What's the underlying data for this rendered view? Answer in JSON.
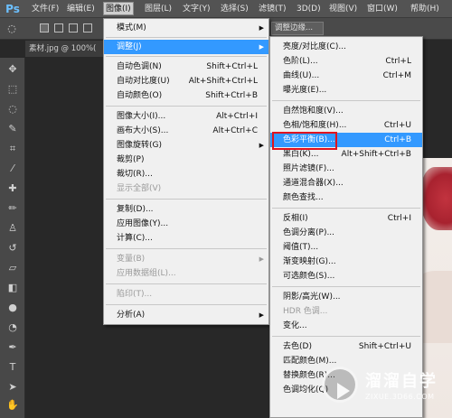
{
  "app": {
    "logo": "Ps"
  },
  "menubar": [
    "文件(F)",
    "编辑(E)",
    "图像(I)",
    "图层(L)",
    "文字(Y)",
    "选择(S)",
    "滤镜(T)",
    "3D(D)",
    "视图(V)",
    "窗口(W)",
    "帮助(H)"
  ],
  "options_bar": {
    "button_label": "调整边缘..."
  },
  "document_tab": {
    "title": "素材.jpg @ 100%("
  },
  "image_menu": {
    "items": [
      {
        "label": "模式(M)",
        "shortcut": "",
        "submenu": true,
        "disabled": false
      },
      {
        "label": "调整(J)",
        "shortcut": "",
        "submenu": true,
        "disabled": false,
        "highlighted": true
      },
      {
        "label": "自动色调(N)",
        "shortcut": "Shift+Ctrl+L",
        "disabled": false
      },
      {
        "label": "自动对比度(U)",
        "shortcut": "Alt+Shift+Ctrl+L",
        "disabled": false
      },
      {
        "label": "自动颜色(O)",
        "shortcut": "Shift+Ctrl+B",
        "disabled": false
      },
      {
        "label": "图像大小(I)...",
        "shortcut": "Alt+Ctrl+I",
        "disabled": false
      },
      {
        "label": "画布大小(S)...",
        "shortcut": "Alt+Ctrl+C",
        "disabled": false
      },
      {
        "label": "图像旋转(G)",
        "shortcut": "",
        "submenu": true,
        "disabled": false
      },
      {
        "label": "裁剪(P)",
        "shortcut": "",
        "disabled": false
      },
      {
        "label": "裁切(R)...",
        "shortcut": "",
        "disabled": false
      },
      {
        "label": "显示全部(V)",
        "shortcut": "",
        "disabled": true
      },
      {
        "label": "复制(D)...",
        "shortcut": "",
        "disabled": false
      },
      {
        "label": "应用图像(Y)...",
        "shortcut": "",
        "disabled": false
      },
      {
        "label": "计算(C)...",
        "shortcut": "",
        "disabled": false
      },
      {
        "label": "变量(B)",
        "shortcut": "",
        "submenu": true,
        "disabled": true
      },
      {
        "label": "应用数据组(L)...",
        "shortcut": "",
        "disabled": true
      },
      {
        "label": "陷印(T)...",
        "shortcut": "",
        "disabled": true
      },
      {
        "label": "分析(A)",
        "shortcut": "",
        "submenu": true,
        "disabled": false
      }
    ]
  },
  "adjust_submenu": {
    "items": [
      {
        "label": "亮度/对比度(C)...",
        "shortcut": "",
        "disabled": false
      },
      {
        "label": "色阶(L)...",
        "shortcut": "Ctrl+L",
        "disabled": false
      },
      {
        "label": "曲线(U)...",
        "shortcut": "Ctrl+M",
        "disabled": false
      },
      {
        "label": "曝光度(E)...",
        "shortcut": "",
        "disabled": false
      },
      {
        "label": "自然饱和度(V)...",
        "shortcut": "",
        "disabled": false
      },
      {
        "label": "色相/饱和度(H)...",
        "shortcut": "Ctrl+U",
        "disabled": false
      },
      {
        "label": "色彩平衡(B)...",
        "shortcut": "Ctrl+B",
        "disabled": false,
        "highlighted": true
      },
      {
        "label": "黑白(K)...",
        "shortcut": "Alt+Shift+Ctrl+B",
        "disabled": false
      },
      {
        "label": "照片滤镜(F)...",
        "shortcut": "",
        "disabled": false
      },
      {
        "label": "通道混合器(X)...",
        "shortcut": "",
        "disabled": false
      },
      {
        "label": "颜色查找...",
        "shortcut": "",
        "disabled": false
      },
      {
        "label": "反相(I)",
        "shortcut": "Ctrl+I",
        "disabled": false
      },
      {
        "label": "色调分离(P)...",
        "shortcut": "",
        "disabled": false
      },
      {
        "label": "阈值(T)...",
        "shortcut": "",
        "disabled": false
      },
      {
        "label": "渐变映射(G)...",
        "shortcut": "",
        "disabled": false
      },
      {
        "label": "可选颜色(S)...",
        "shortcut": "",
        "disabled": false
      },
      {
        "label": "阴影/高光(W)...",
        "shortcut": "",
        "disabled": false
      },
      {
        "label": "HDR 色调...",
        "shortcut": "",
        "disabled": true
      },
      {
        "label": "变化...",
        "shortcut": "",
        "disabled": false
      },
      {
        "label": "去色(D)",
        "shortcut": "Shift+Ctrl+U",
        "disabled": false
      },
      {
        "label": "匹配颜色(M)...",
        "shortcut": "",
        "disabled": false
      },
      {
        "label": "替换颜色(R)...",
        "shortcut": "",
        "disabled": false
      },
      {
        "label": "色调均化(Q)",
        "shortcut": "",
        "disabled": false
      }
    ]
  },
  "watermark": {
    "title": "溜溜自学",
    "url": "ZIXUE.3D66.COM"
  },
  "colors": {
    "highlight": "#3399ff",
    "menu_bg": "#f0f0f0",
    "callout_red": "#e0141e",
    "ps_blue": "#6cc0ff"
  }
}
